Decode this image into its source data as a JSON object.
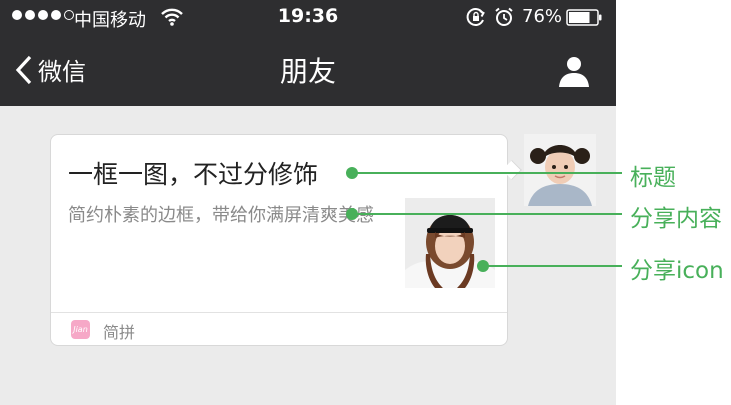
{
  "status_bar": {
    "carrier": "中国移动",
    "time": "19:36",
    "battery_percent": "76%",
    "signal_strength": 4,
    "battery_level": 0.76
  },
  "nav_bar": {
    "back_label": "微信",
    "title": "朋友"
  },
  "card": {
    "headline": "一框一图，不过分修饰",
    "description": "简约朴素的边框，带给你满屏清爽美感",
    "app_icon_text": "Jian",
    "app_name": "简拼"
  },
  "annotations": [
    {
      "label": "标题"
    },
    {
      "label": "分享内容"
    },
    {
      "label": "分享icon"
    }
  ],
  "colors": {
    "bar_background": "#2e2e30",
    "page_background": "#ebebeb",
    "annotation_green": "#48b05a",
    "app_icon_pink": "#f6a8c7"
  }
}
